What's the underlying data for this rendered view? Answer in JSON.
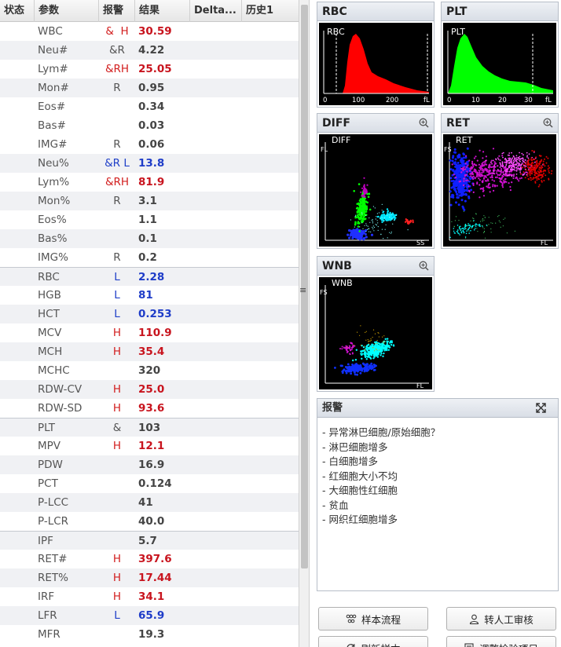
{
  "table": {
    "headers": {
      "status": "状态",
      "param": "参数",
      "flag": "报警",
      "result": "结果",
      "delta": "Delta...",
      "history": "历史1"
    },
    "rows": [
      {
        "param": "WBC",
        "flag": "&  H",
        "value": "30.59",
        "flag_level": "hi",
        "value_level": "hi"
      },
      {
        "param": "Neu#",
        "flag": "&R",
        "value": "4.22",
        "flag_level": "",
        "value_level": ""
      },
      {
        "param": "Lym#",
        "flag": "&RH",
        "value": "25.05",
        "flag_level": "hi",
        "value_level": "hi"
      },
      {
        "param": "Mon#",
        "flag": "R",
        "value": "0.95",
        "flag_level": "",
        "value_level": ""
      },
      {
        "param": "Eos#",
        "flag": "",
        "value": "0.34",
        "flag_level": "",
        "value_level": ""
      },
      {
        "param": "Bas#",
        "flag": "",
        "value": "0.03",
        "flag_level": "",
        "value_level": ""
      },
      {
        "param": "IMG#",
        "flag": "R",
        "value": "0.06",
        "flag_level": "",
        "value_level": ""
      },
      {
        "param": "Neu%",
        "flag": "&R L",
        "value": "13.8",
        "flag_level": "lo",
        "value_level": "lo"
      },
      {
        "param": "Lym%",
        "flag": "&RH",
        "value": "81.9",
        "flag_level": "hi",
        "value_level": "hi"
      },
      {
        "param": "Mon%",
        "flag": "R",
        "value": "3.1",
        "flag_level": "",
        "value_level": ""
      },
      {
        "param": "Eos%",
        "flag": "",
        "value": "1.1",
        "flag_level": "",
        "value_level": ""
      },
      {
        "param": "Bas%",
        "flag": "",
        "value": "0.1",
        "flag_level": "",
        "value_level": ""
      },
      {
        "param": "IMG%",
        "flag": "R",
        "value": "0.2",
        "flag_level": "",
        "value_level": ""
      },
      {
        "param": "RBC",
        "flag": "L",
        "value": "2.28",
        "flag_level": "lo",
        "value_level": "lo"
      },
      {
        "param": "HGB",
        "flag": "L",
        "value": "81",
        "flag_level": "lo",
        "value_level": "lo"
      },
      {
        "param": "HCT",
        "flag": "L",
        "value": "0.253",
        "flag_level": "lo",
        "value_level": "lo"
      },
      {
        "param": "MCV",
        "flag": "H",
        "value": "110.9",
        "flag_level": "hi",
        "value_level": "hi"
      },
      {
        "param": "MCH",
        "flag": "H",
        "value": "35.4",
        "flag_level": "hi",
        "value_level": "hi"
      },
      {
        "param": "MCHC",
        "flag": "",
        "value": "320",
        "flag_level": "",
        "value_level": ""
      },
      {
        "param": "RDW-CV",
        "flag": "H",
        "value": "25.0",
        "flag_level": "hi",
        "value_level": "hi"
      },
      {
        "param": "RDW-SD",
        "flag": "H",
        "value": "93.6",
        "flag_level": "hi",
        "value_level": "hi"
      },
      {
        "param": "PLT",
        "flag": "&",
        "value": "103",
        "flag_level": "",
        "value_level": ""
      },
      {
        "param": "MPV",
        "flag": "H",
        "value": "12.1",
        "flag_level": "hi",
        "value_level": "hi"
      },
      {
        "param": "PDW",
        "flag": "",
        "value": "16.9",
        "flag_level": "",
        "value_level": ""
      },
      {
        "param": "PCT",
        "flag": "",
        "value": "0.124",
        "flag_level": "",
        "value_level": ""
      },
      {
        "param": "P-LCC",
        "flag": "",
        "value": "41",
        "flag_level": "",
        "value_level": ""
      },
      {
        "param": "P-LCR",
        "flag": "",
        "value": "40.0",
        "flag_level": "",
        "value_level": ""
      },
      {
        "param": "IPF",
        "flag": "",
        "value": "5.7",
        "flag_level": "",
        "value_level": ""
      },
      {
        "param": "RET#",
        "flag": "H",
        "value": "397.6",
        "flag_level": "hi",
        "value_level": "hi"
      },
      {
        "param": "RET%",
        "flag": "H",
        "value": "17.44",
        "flag_level": "hi",
        "value_level": "hi"
      },
      {
        "param": "IRF",
        "flag": "H",
        "value": "34.1",
        "flag_level": "hi",
        "value_level": "hi"
      },
      {
        "param": "LFR",
        "flag": "L",
        "value": "65.9",
        "flag_level": "lo",
        "value_level": "lo"
      },
      {
        "param": "MFR",
        "flag": "",
        "value": "19.3",
        "flag_level": "",
        "value_level": ""
      }
    ]
  },
  "panels": {
    "rbc": {
      "title": "RBC",
      "plot_label": "RBC",
      "ticks": [
        "0",
        "100",
        "200",
        "fL"
      ]
    },
    "plt": {
      "title": "PLT",
      "plot_label": "PLT",
      "ticks": [
        "0",
        "10",
        "20",
        "30",
        "fL"
      ]
    },
    "diff": {
      "title": "DIFF",
      "plot_label": "DIFF",
      "y_axis": "FL",
      "x_axis": "SS"
    },
    "ret": {
      "title": "RET",
      "plot_label": "RET",
      "y_axis": "FS",
      "x_axis": "FL"
    },
    "wnb": {
      "title": "WNB",
      "plot_label": "WNB",
      "y_axis": "FS",
      "x_axis": "FL"
    }
  },
  "alarm": {
    "title": "报警",
    "items": [
      "- 异常淋巴细胞/原始细胞？",
      "- 淋巴细胞增多",
      "- 白细胞增多",
      "- 红细胞大小不均",
      "- 大细胞性红细胞",
      "- 贫血",
      "- 网织红细胞增多"
    ]
  },
  "buttons": {
    "sample_flow": "样本流程",
    "manual_review": "转人工审核",
    "refresh_sample": "刷新样本",
    "adjust_items": "调整检验项目"
  },
  "colors": {
    "high": "#c8141e",
    "low": "#1e3cc8",
    "rbc_fill": "#ff0000",
    "plt_fill": "#00ff00"
  }
}
